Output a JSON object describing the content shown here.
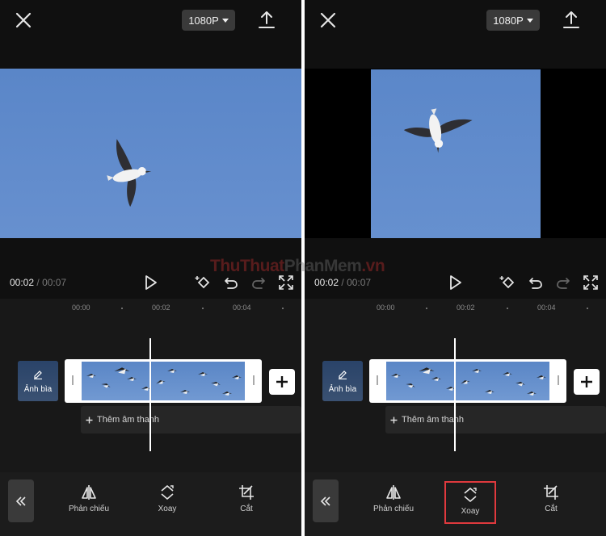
{
  "screens": [
    {
      "resolution": "1080P",
      "time_current": "00:02",
      "time_separator": "/",
      "time_total": "00:07",
      "ruler": [
        "00:00",
        "00:02",
        "00:04"
      ],
      "cover_label": "Ảnh bìa",
      "audio_label": "Thêm âm thanh",
      "tools": [
        {
          "label": "Phản chiếu",
          "icon": "mirror-icon"
        },
        {
          "label": "Xoay",
          "icon": "rotate-icon"
        },
        {
          "label": "Cắt",
          "icon": "crop-icon"
        }
      ],
      "selected_tool": null
    },
    {
      "resolution": "1080P",
      "time_current": "00:02",
      "time_separator": "/",
      "time_total": "00:07",
      "ruler": [
        "00:00",
        "00:02",
        "00:04"
      ],
      "cover_label": "Ảnh bìa",
      "audio_label": "Thêm âm thanh",
      "tools": [
        {
          "label": "Phản chiếu",
          "icon": "mirror-icon"
        },
        {
          "label": "Xoay",
          "icon": "rotate-icon"
        },
        {
          "label": "Cắt",
          "icon": "crop-icon"
        }
      ],
      "selected_tool": "Xoay"
    }
  ],
  "watermark": {
    "part1": "ThuThuat",
    "part2": "PhanMem",
    "part3": ".vn"
  },
  "colors": {
    "background": "#101010",
    "sky": "#5d87c9",
    "highlight": "#e0393e",
    "text": "#e8e8e8"
  }
}
